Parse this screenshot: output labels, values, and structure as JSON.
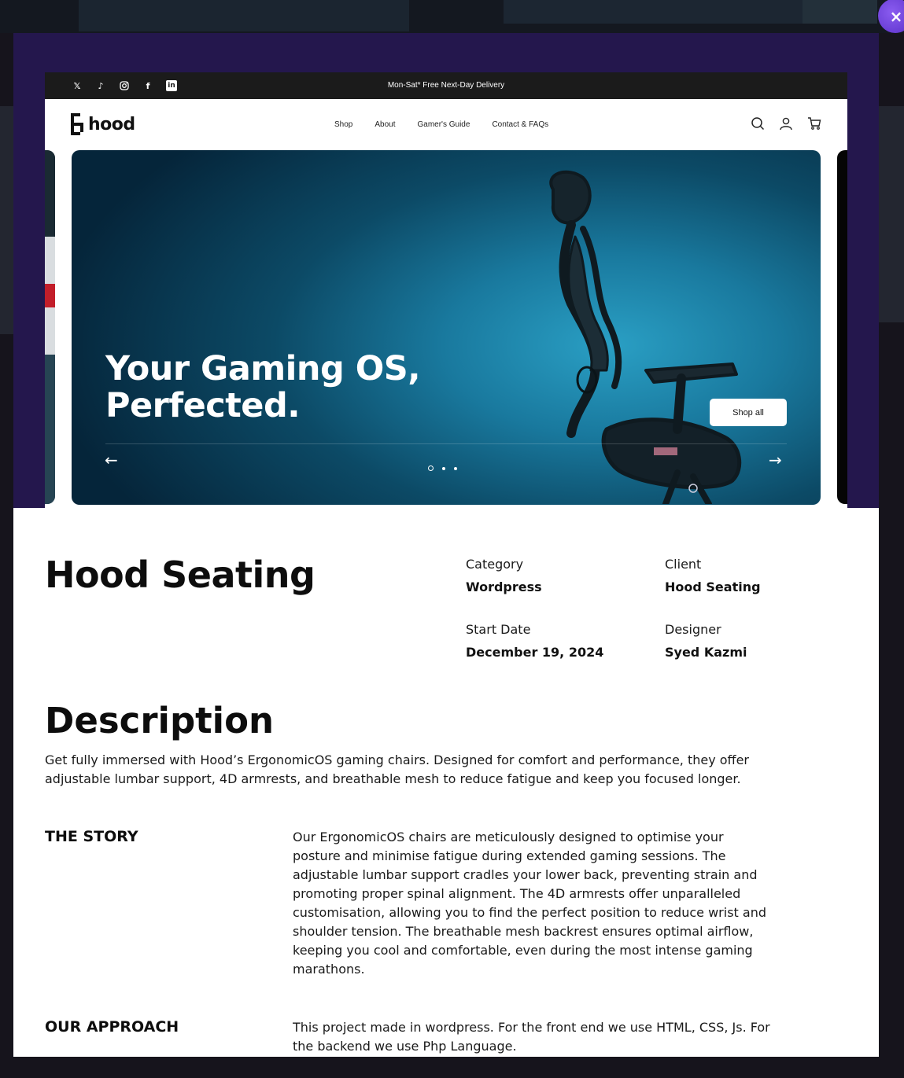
{
  "modal": {
    "close_label": "×"
  },
  "site": {
    "topbar": {
      "promo": "Mon-Sat* Free Next-Day Delivery",
      "social_icons": [
        "x-icon",
        "tiktok-icon",
        "instagram-icon",
        "facebook-icon",
        "linkedin-icon"
      ]
    },
    "logo": "hood",
    "nav": {
      "links": [
        "Shop",
        "About",
        "Gamer's Guide",
        "Contact & FAQs"
      ],
      "icons": [
        "search-icon",
        "account-icon",
        "cart-icon"
      ]
    },
    "hero": {
      "title": "Your Gaming OS,\nPerfected.",
      "cta": "Shop all",
      "prev": "←",
      "next": "→",
      "slide_count": 3,
      "active_slide": 1
    }
  },
  "project": {
    "title": "Hood Seating",
    "meta": {
      "category_label": "Category",
      "category": "Wordpress",
      "client_label": "Client",
      "client": "Hood Seating",
      "start_label": "Start Date",
      "start": "December 19, 2024",
      "designer_label": "Designer",
      "designer": "Syed Kazmi"
    },
    "description_heading": "Description",
    "description": "Get fully immersed with Hood’s ErgonomicOS gaming chairs. Designed for comfort and performance, they offer adjustable lumbar support, 4D armrests, and breathable mesh to reduce fatigue and keep you focused longer.",
    "story_heading": "THE STORY",
    "story": "Our ErgonomicOS chairs are meticulously designed to optimise your posture and minimise fatigue during extended gaming sessions. The adjustable lumbar support cradles your lower back, preventing strain and promoting proper spinal alignment. The 4D armrests offer unparalleled customisation, allowing you to find the perfect position to reduce wrist and shoulder tension. The breathable mesh backrest ensures optimal airflow, keeping you cool and comfortable, even during the most intense gaming marathons.",
    "approach_heading": "OUR APPROACH",
    "approach": "This project made in wordpress. For the front end we use HTML, CSS, Js. For the backend we use Php Language."
  },
  "colors": {
    "modal_hero_bg": "#24174d",
    "close_button": "#6b3fe0",
    "topbar": "#1b1b1b"
  }
}
